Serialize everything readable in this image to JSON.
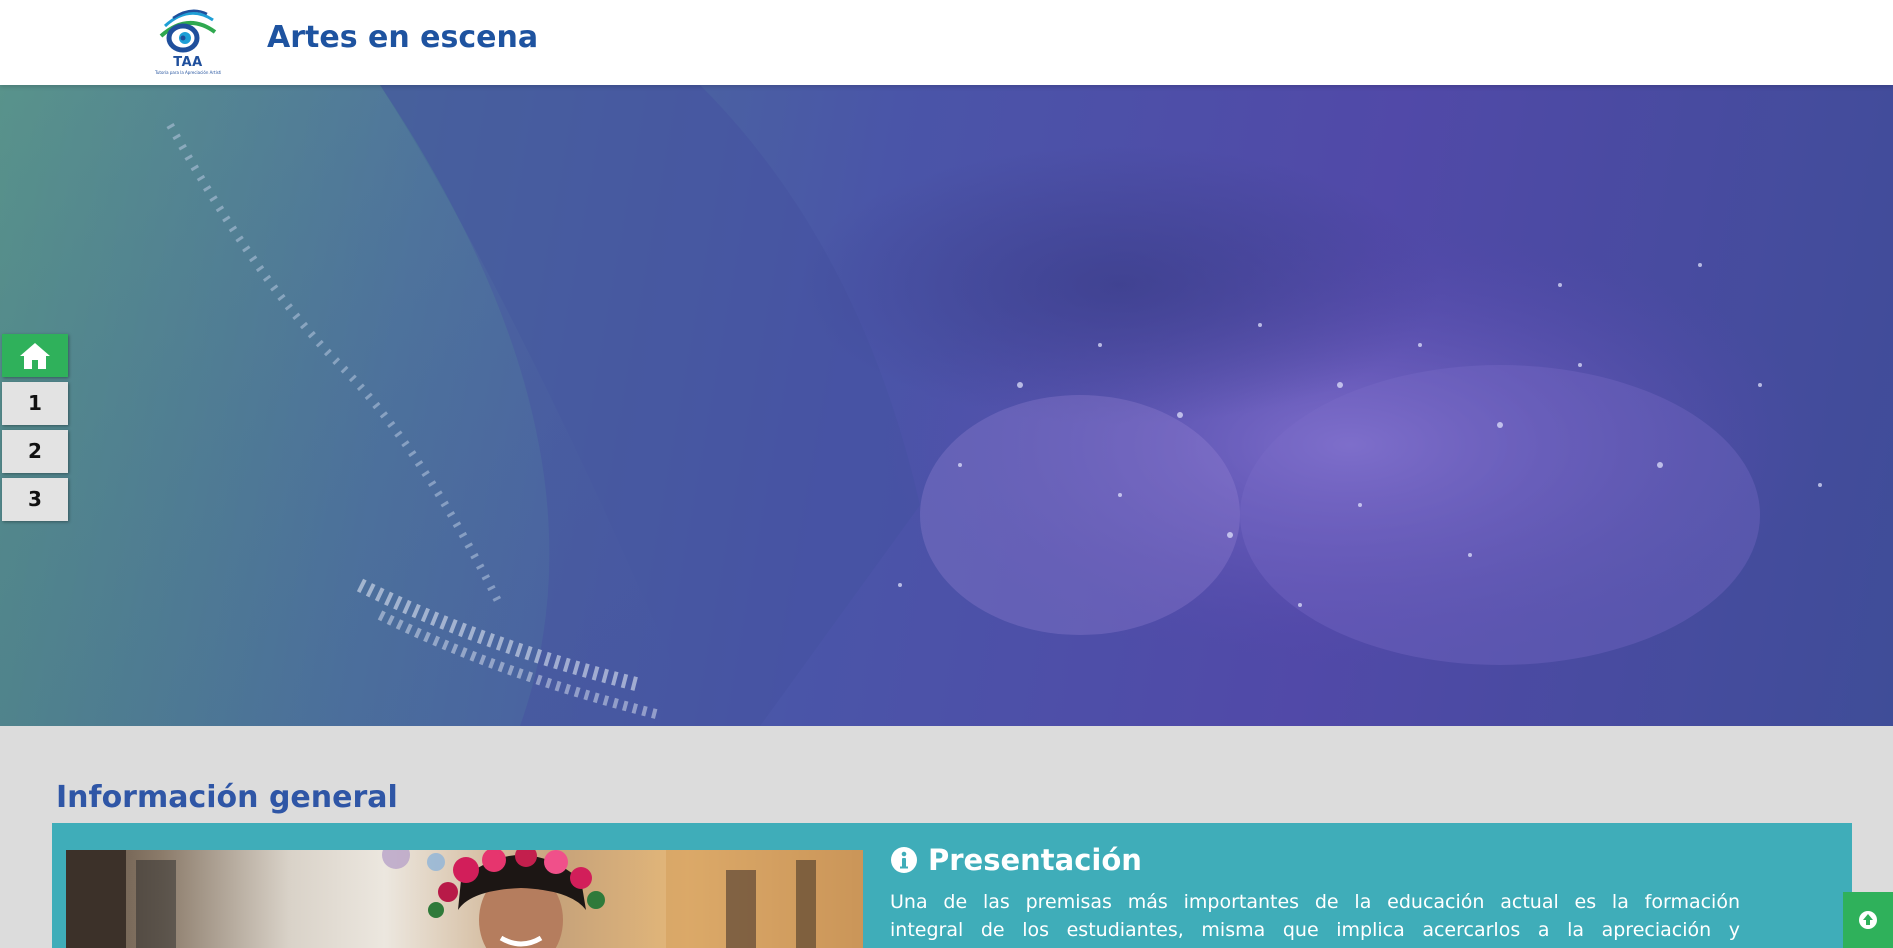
{
  "header": {
    "logo_text": "TAA",
    "logo_subtext": "Tutoría para la Apreciación Artística",
    "title": "Artes en escena"
  },
  "sidenav": {
    "home_icon": "home-icon",
    "items": [
      {
        "label": "1"
      },
      {
        "label": "2"
      },
      {
        "label": "3"
      }
    ],
    "active_color": "#2fb15b"
  },
  "section": {
    "title": "Información general"
  },
  "presentacion": {
    "icon": "info-circle-icon",
    "heading": "Presentación",
    "line1": "Una de las premisas más importantes de la educación actual es la formación",
    "line2": "integral de los estudiantes, misma que implica acercarlos a la apreciación y"
  },
  "scroll_top": {
    "icon": "arrow-up-circle-icon"
  },
  "colors": {
    "brand_blue": "#1e53a0",
    "panel_teal": "#3fadb9",
    "accent_green": "#2fb15b",
    "page_bg": "#dcdcdc"
  }
}
